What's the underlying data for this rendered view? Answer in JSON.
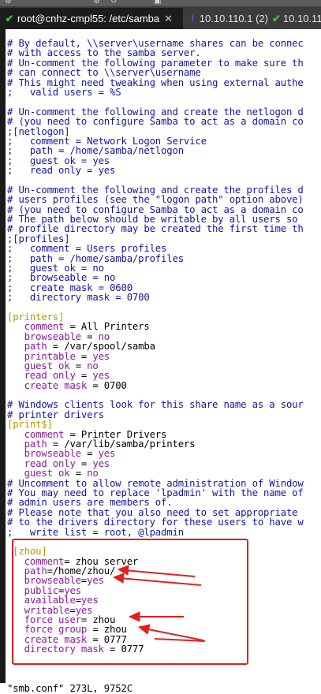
{
  "toolbar": {
    "icon_glyphs": [
      "settings-icon",
      "refresh-icon",
      "image-icon"
    ]
  },
  "tabs": [
    {
      "label": "root@cnhz-cmpl55: /etc/samba",
      "icon": "check-icon",
      "color": "#35c235",
      "active": true,
      "close": "✕"
    },
    {
      "label": "10.10.110.1 (2)",
      "icon": "warning-icon",
      "color": "#2f6fd6",
      "active": false
    },
    {
      "label": "10.10.11",
      "icon": "check-icon",
      "color": "#35c235",
      "active": false
    }
  ],
  "editor": {
    "lines": [
      [
        {
          "t": "# By default, \\\\server\\username shares can be connec",
          "c": "com"
        }
      ],
      [
        {
          "t": "# with access to the samba server.",
          "c": "com"
        }
      ],
      [
        {
          "t": "# Un-comment the following parameter to make sure th",
          "c": "com"
        }
      ],
      [
        {
          "t": "# can connect to \\\\server\\username",
          "c": "com"
        }
      ],
      [
        {
          "t": "# This might need tweaking when using external authe",
          "c": "com"
        }
      ],
      [
        {
          "t": ";   valid users = %S",
          "c": "com"
        }
      ],
      [
        {
          "t": "",
          "c": "com"
        }
      ],
      [
        {
          "t": "# Un-comment the following and create the netlogon d",
          "c": "com"
        }
      ],
      [
        {
          "t": "# (you need to configure Samba to act as a domain co",
          "c": "com"
        }
      ],
      [
        {
          "t": ";[netlogon]",
          "c": "com"
        }
      ],
      [
        {
          "t": ";   comment = Network Logon Service",
          "c": "com"
        }
      ],
      [
        {
          "t": ";   path = /home/samba/netlogon",
          "c": "com"
        }
      ],
      [
        {
          "t": ";   guest ok = yes",
          "c": "com"
        }
      ],
      [
        {
          "t": ";   read only = yes",
          "c": "com"
        }
      ],
      [
        {
          "t": "",
          "c": "com"
        }
      ],
      [
        {
          "t": "# Un-comment the following and create the profiles d",
          "c": "com"
        }
      ],
      [
        {
          "t": "# users profiles (see the \"logon path\" option above)",
          "c": "com"
        }
      ],
      [
        {
          "t": "# (you need to configure Samba to act as a domain co",
          "c": "com"
        }
      ],
      [
        {
          "t": "# The path below should be writable by all users so ",
          "c": "com"
        }
      ],
      [
        {
          "t": "# profile directory may be created the first time th",
          "c": "com"
        }
      ],
      [
        {
          "t": ";[profiles]",
          "c": "com"
        }
      ],
      [
        {
          "t": ";   comment = Users profiles",
          "c": "com"
        }
      ],
      [
        {
          "t": ";   path = /home/samba/profiles",
          "c": "com"
        }
      ],
      [
        {
          "t": ";   guest ok = no",
          "c": "com"
        }
      ],
      [
        {
          "t": ";   browseable = no",
          "c": "com"
        }
      ],
      [
        {
          "t": ";   create mask = 0600",
          "c": "com"
        }
      ],
      [
        {
          "t": ";   directory mask = 0700",
          "c": "com"
        }
      ],
      [
        {
          "t": "",
          "c": "com"
        }
      ],
      [
        {
          "t": "[printers]",
          "c": "sec"
        }
      ],
      [
        {
          "t": "   comment",
          "c": "key"
        },
        {
          "t": " = All Printers",
          "c": "val"
        }
      ],
      [
        {
          "t": "   browseable",
          "c": "key"
        },
        {
          "t": " = ",
          "c": "val"
        },
        {
          "t": "no",
          "c": "key"
        }
      ],
      [
        {
          "t": "   path",
          "c": "key"
        },
        {
          "t": " = /var/spool/samba",
          "c": "val"
        }
      ],
      [
        {
          "t": "   printable",
          "c": "key"
        },
        {
          "t": " = ",
          "c": "val"
        },
        {
          "t": "yes",
          "c": "key"
        }
      ],
      [
        {
          "t": "   guest ok",
          "c": "key"
        },
        {
          "t": " = ",
          "c": "val"
        },
        {
          "t": "no",
          "c": "key"
        }
      ],
      [
        {
          "t": "   read only",
          "c": "key"
        },
        {
          "t": " = ",
          "c": "val"
        },
        {
          "t": "yes",
          "c": "key"
        }
      ],
      [
        {
          "t": "   create mask",
          "c": "key"
        },
        {
          "t": " = 0700",
          "c": "val"
        }
      ],
      [
        {
          "t": "",
          "c": "com"
        }
      ],
      [
        {
          "t": "# Windows clients look for this share name as a sour",
          "c": "com"
        }
      ],
      [
        {
          "t": "# printer drivers",
          "c": "com"
        }
      ],
      [
        {
          "t": "[print$]",
          "c": "sec"
        }
      ],
      [
        {
          "t": "   comment",
          "c": "key"
        },
        {
          "t": " = Printer Drivers",
          "c": "val"
        }
      ],
      [
        {
          "t": "   path",
          "c": "key"
        },
        {
          "t": " = /var/lib/samba/printers",
          "c": "val"
        }
      ],
      [
        {
          "t": "   browseable",
          "c": "key"
        },
        {
          "t": " = ",
          "c": "val"
        },
        {
          "t": "yes",
          "c": "key"
        }
      ],
      [
        {
          "t": "   read only",
          "c": "key"
        },
        {
          "t": " = ",
          "c": "val"
        },
        {
          "t": "yes",
          "c": "key"
        }
      ],
      [
        {
          "t": "   guest ok",
          "c": "key"
        },
        {
          "t": " = ",
          "c": "val"
        },
        {
          "t": "no",
          "c": "key"
        }
      ],
      [
        {
          "t": "# Uncomment to allow remote administration of Window",
          "c": "com"
        }
      ],
      [
        {
          "t": "# You may need to replace 'lpadmin' with the name of",
          "c": "com"
        }
      ],
      [
        {
          "t": "# admin users are members of.",
          "c": "com"
        }
      ],
      [
        {
          "t": "# Please note that you also need to set appropriate ",
          "c": "com"
        }
      ],
      [
        {
          "t": "# to the drivers directory for these users to have w",
          "c": "com"
        }
      ],
      [
        {
          "t": ";   write list = root, @lpadmin",
          "c": "com"
        }
      ],
      [
        {
          "t": "",
          "c": "com"
        }
      ],
      [
        {
          "t": " [zhou]",
          "c": "sec"
        }
      ],
      [
        {
          "t": "   comment",
          "c": "key"
        },
        {
          "t": "= zhou server",
          "c": "val"
        }
      ],
      [
        {
          "t": "   path",
          "c": "key"
        },
        {
          "t": "=/home/zhou/",
          "c": "val"
        }
      ],
      [
        {
          "t": "   browseable",
          "c": "key"
        },
        {
          "t": "=",
          "c": "val"
        },
        {
          "t": "yes",
          "c": "key"
        }
      ],
      [
        {
          "t": "   public",
          "c": "key"
        },
        {
          "t": "=",
          "c": "val"
        },
        {
          "t": "yes",
          "c": "key"
        }
      ],
      [
        {
          "t": "   available",
          "c": "key"
        },
        {
          "t": "=",
          "c": "val"
        },
        {
          "t": "yes",
          "c": "key"
        }
      ],
      [
        {
          "t": "   writable",
          "c": "key"
        },
        {
          "t": "=",
          "c": "val"
        },
        {
          "t": "yes",
          "c": "key"
        }
      ],
      [
        {
          "t": "   force user",
          "c": "key"
        },
        {
          "t": "= zhou",
          "c": "val"
        }
      ],
      [
        {
          "t": "   force group",
          "c": "key"
        },
        {
          "t": " = zhou",
          "c": "val"
        }
      ],
      [
        {
          "t": "   create mask",
          "c": "key"
        },
        {
          "t": " = 0777",
          "c": "val"
        }
      ],
      [
        {
          "t": "   directory mask",
          "c": "key"
        },
        {
          "t": " = 0777",
          "c": "val"
        }
      ],
      [
        {
          "t": "",
          "c": "com"
        }
      ],
      [
        {
          "t": "",
          "c": "com"
        }
      ],
      [
        {
          "t": "",
          "c": "com"
        }
      ],
      [
        {
          "t": "\"smb.conf\" 273L, 9752C",
          "c": "str"
        }
      ]
    ]
  },
  "annotation": {
    "color": "#e02020",
    "arrow_count": 5
  }
}
